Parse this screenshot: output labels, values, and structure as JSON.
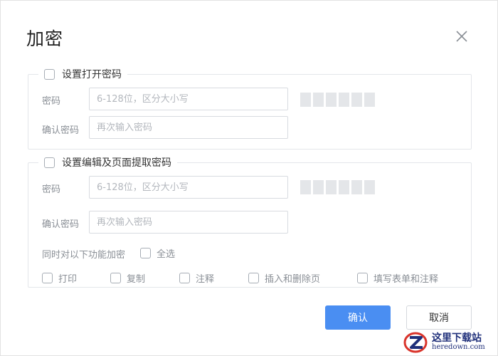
{
  "dialog": {
    "title": "加密",
    "close_icon": "close-icon"
  },
  "open_password": {
    "checkbox_label": "设置打开密码",
    "checked": false,
    "password_label": "密码",
    "password_placeholder": "6-128位，区分大小写",
    "confirm_label": "确认密码",
    "confirm_placeholder": "再次输入密码",
    "strength_segments": 6
  },
  "edit_password": {
    "checkbox_label": "设置编辑及页面提取密码",
    "checked": false,
    "password_label": "密码",
    "password_placeholder": "6-128位，区分大小写",
    "confirm_label": "确认密码",
    "confirm_placeholder": "再次输入密码",
    "strength_segments": 6,
    "encrypt_features_label": "同时对以下功能加密",
    "select_all_label": "全选",
    "permissions": [
      {
        "label": "打印",
        "checked": false
      },
      {
        "label": "复制",
        "checked": false
      },
      {
        "label": "注释",
        "checked": false
      },
      {
        "label": "插入和删除页",
        "checked": false
      },
      {
        "label": "填写表单和注释",
        "checked": false
      }
    ]
  },
  "footer": {
    "confirm_label": "确认",
    "cancel_label": "取消"
  },
  "watermark": {
    "cn_text": "这里下载站",
    "en_text": "heredown.com"
  },
  "colors": {
    "primary": "#4a8ef2",
    "border": "#e3e6ea",
    "muted_text": "#8a8f96"
  }
}
